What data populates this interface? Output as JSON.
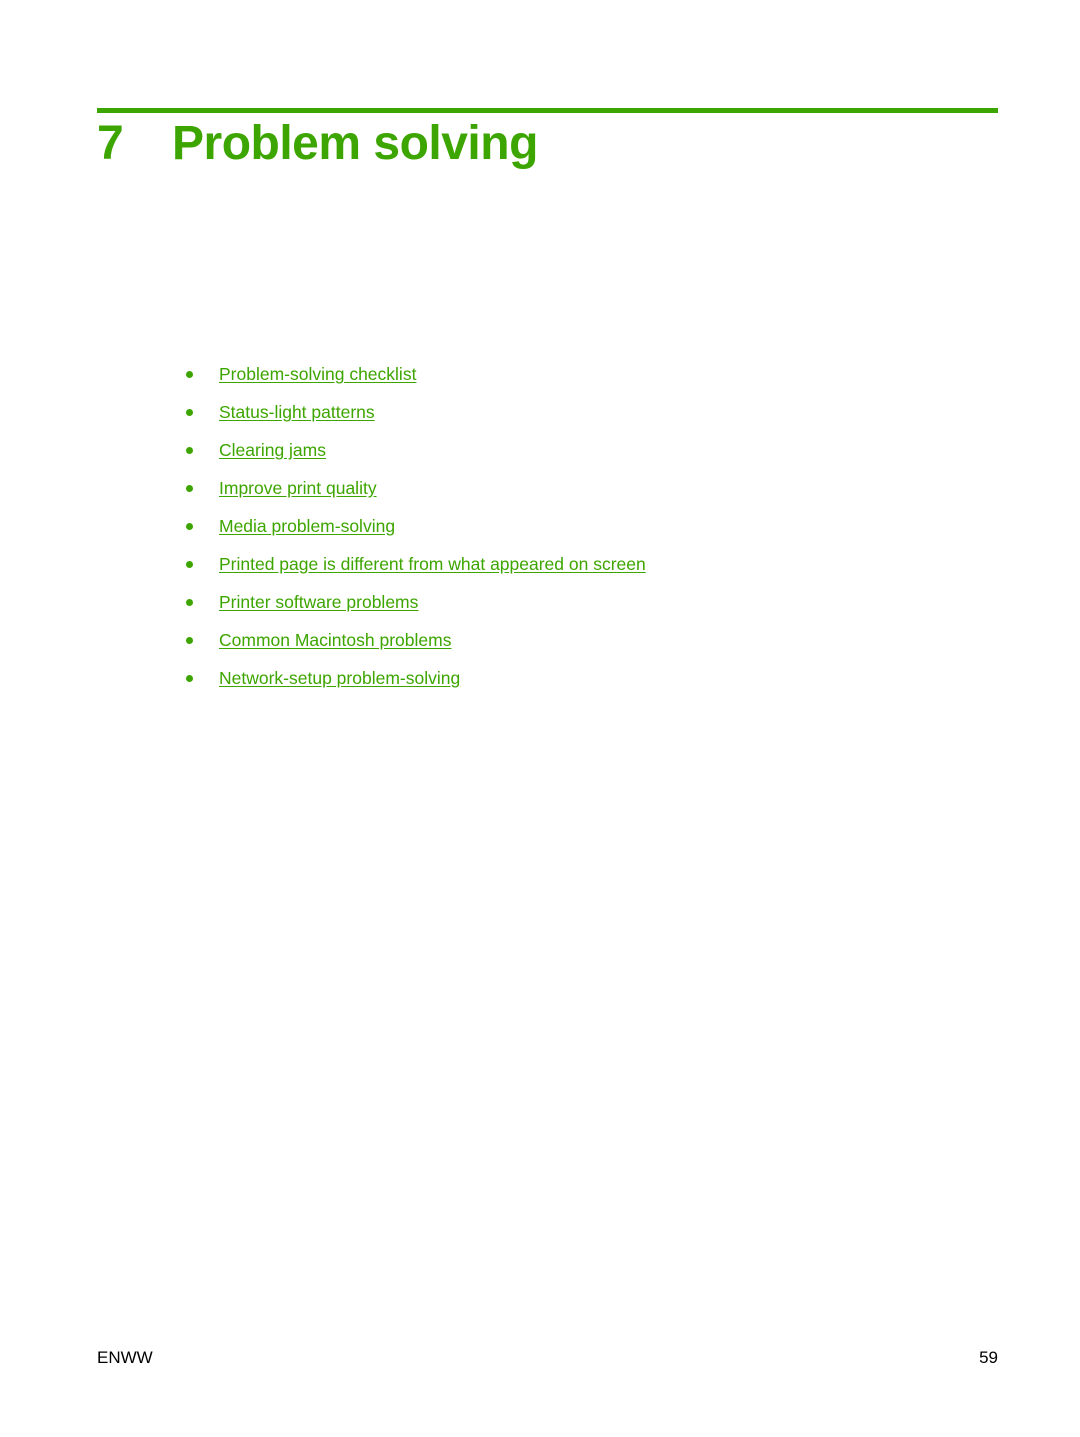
{
  "document": {
    "chapter_number": "7",
    "chapter_title": "Problem solving",
    "accent_color": "#3da500",
    "text_color": "#000000",
    "background_color": "#ffffff"
  },
  "toc": {
    "items": [
      {
        "label": "Problem-solving checklist"
      },
      {
        "label": "Status-light patterns"
      },
      {
        "label": "Clearing jams"
      },
      {
        "label": "Improve print quality"
      },
      {
        "label": "Media problem-solving"
      },
      {
        "label": "Printed page is different from what appeared on screen"
      },
      {
        "label": "Printer software problems"
      },
      {
        "label": "Common Macintosh problems"
      },
      {
        "label": "Network-setup problem-solving"
      }
    ]
  },
  "footer": {
    "left": "ENWW",
    "page_number": "59"
  }
}
